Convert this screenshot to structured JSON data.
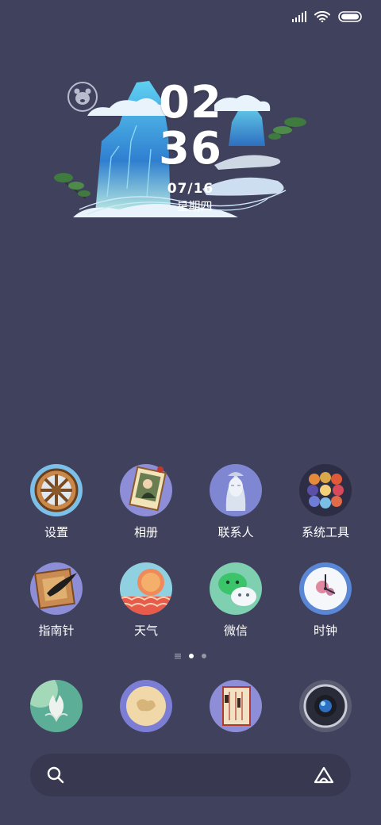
{
  "clock": {
    "hour": "02",
    "minute": "36",
    "date": "07/16",
    "weekday": "星期四"
  },
  "apps": [
    {
      "name": "设置",
      "icon": "wheel-icon"
    },
    {
      "name": "相册",
      "icon": "portrait-scroll-icon"
    },
    {
      "name": "联系人",
      "icon": "statue-head-icon"
    },
    {
      "name": "系统工具",
      "icon": "folder-grid-icon"
    },
    {
      "name": "指南针",
      "icon": "compass-spoon-icon"
    },
    {
      "name": "天气",
      "icon": "sunrise-waves-icon"
    },
    {
      "name": "微信",
      "icon": "chat-bubbles-icon"
    },
    {
      "name": "时钟",
      "icon": "clock-icon"
    }
  ],
  "dock": [
    {
      "icon": "lotus-icon"
    },
    {
      "icon": "moon-globe-icon"
    },
    {
      "icon": "ancient-book-icon"
    },
    {
      "icon": "camera-lens-icon"
    }
  ],
  "search": {
    "placeholder": ""
  },
  "pager": {
    "pages": 2,
    "active": 1
  },
  "colors": {
    "background": "#40415d",
    "search_bar": "#383950",
    "mountain_blue": "#3a8fd8",
    "cloud_white": "#e8f3fb"
  }
}
